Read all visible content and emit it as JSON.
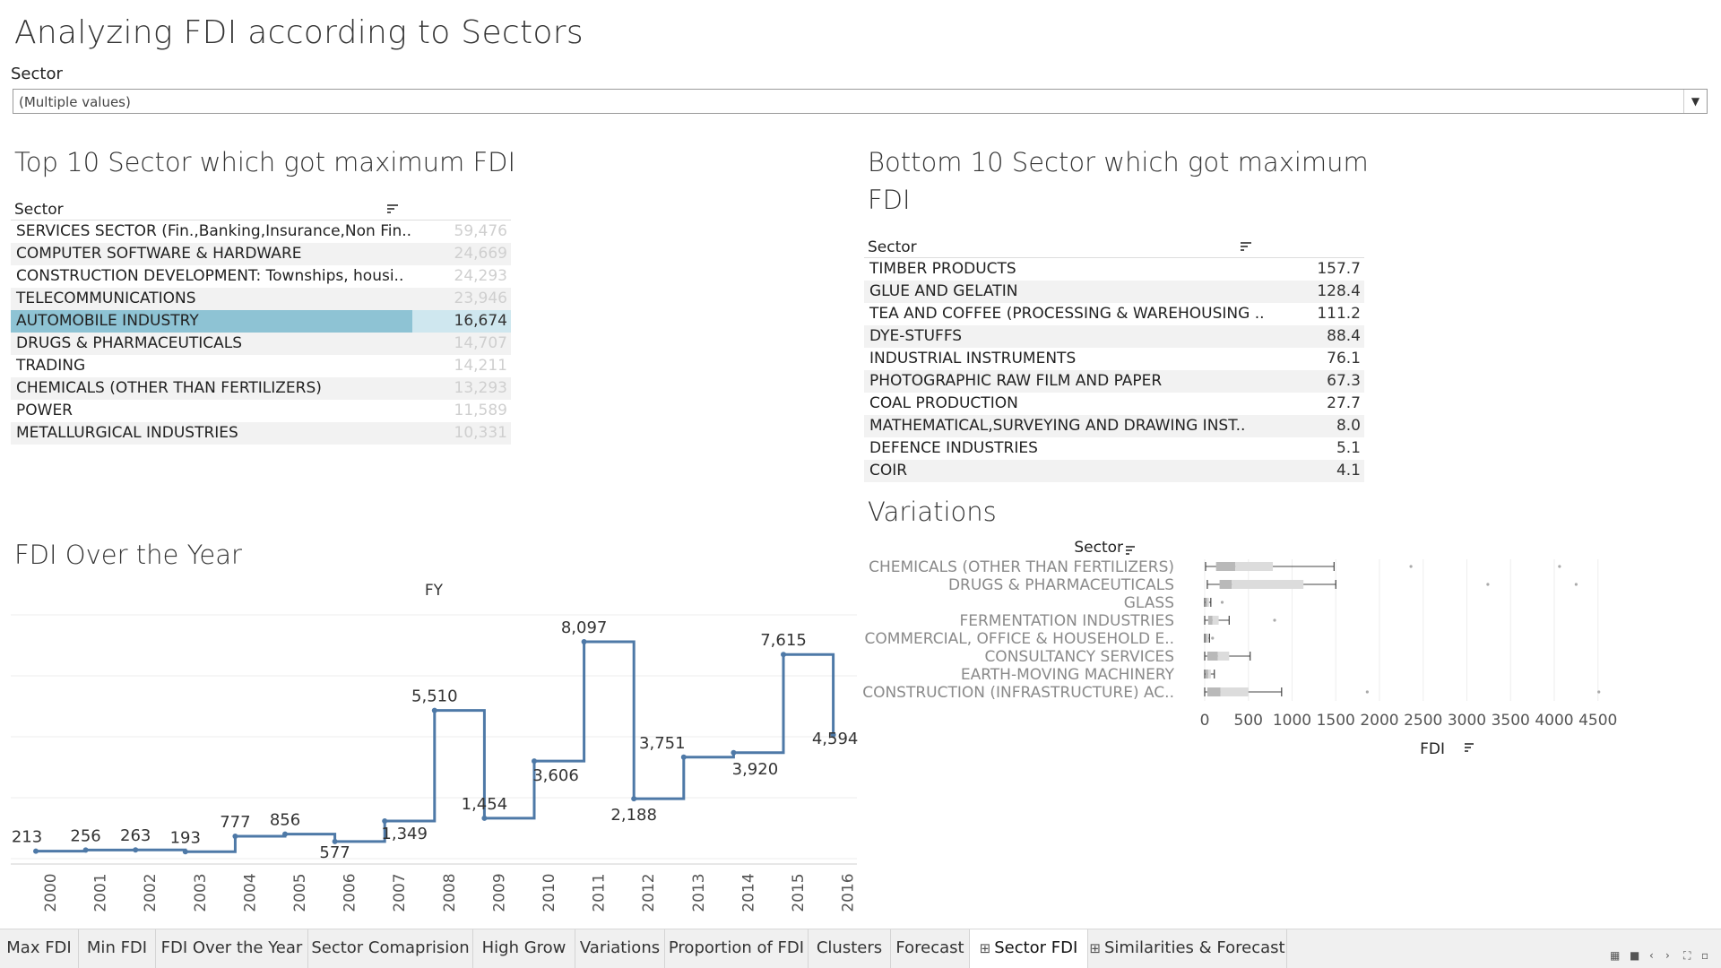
{
  "title": "Analyzing FDI according to Sectors",
  "filter": {
    "label": "Sector",
    "value": "(Multiple values)"
  },
  "top10": {
    "title": "Top 10 Sector which got maximum FDI",
    "header": "Sector",
    "rows": [
      {
        "name": "SERVICES SECTOR (Fin.,Banking,Insurance,Non Fin..",
        "value": "59,476"
      },
      {
        "name": "COMPUTER SOFTWARE & HARDWARE",
        "value": "24,669"
      },
      {
        "name": "CONSTRUCTION DEVELOPMENT: Townships, housi..",
        "value": "24,293"
      },
      {
        "name": "TELECOMMUNICATIONS",
        "value": "23,946"
      },
      {
        "name": "AUTOMOBILE INDUSTRY",
        "value": "16,674"
      },
      {
        "name": "DRUGS & PHARMACEUTICALS",
        "value": "14,707"
      },
      {
        "name": "TRADING",
        "value": "14,211"
      },
      {
        "name": "CHEMICALS (OTHER THAN FERTILIZERS)",
        "value": "13,293"
      },
      {
        "name": "POWER",
        "value": "11,589"
      },
      {
        "name": "METALLURGICAL INDUSTRIES",
        "value": "10,331"
      }
    ]
  },
  "bottom10": {
    "title_line1": "Bottom 10 Sector which got maximum",
    "title_line2": "FDI",
    "header": "Sector",
    "rows": [
      {
        "name": "TIMBER PRODUCTS",
        "value": "157.7"
      },
      {
        "name": "GLUE AND GELATIN",
        "value": "128.4"
      },
      {
        "name": "TEA AND COFFEE (PROCESSING & WAREHOUSING ..",
        "value": "111.2"
      },
      {
        "name": "DYE-STUFFS",
        "value": "88.4"
      },
      {
        "name": "INDUSTRIAL INSTRUMENTS",
        "value": "76.1"
      },
      {
        "name": "PHOTOGRAPHIC RAW FILM AND PAPER",
        "value": "67.3"
      },
      {
        "name": "COAL PRODUCTION",
        "value": "27.7"
      },
      {
        "name": "MATHEMATICAL,SURVEYING AND DRAWING INST..",
        "value": "8.0"
      },
      {
        "name": "DEFENCE INDUSTRIES",
        "value": "5.1"
      },
      {
        "name": "COIR",
        "value": "4.1"
      }
    ]
  },
  "chart_data": [
    {
      "type": "line",
      "title": "FDI Over the Year",
      "xlabel": "FY",
      "ylabel": "",
      "step": true,
      "x": [
        "2000",
        "2001",
        "2002",
        "2003",
        "2004",
        "2005",
        "2006",
        "2007",
        "2008",
        "2009",
        "2010",
        "2011",
        "2012",
        "2013",
        "2014",
        "2015",
        "2016"
      ],
      "values": [
        213,
        256,
        263,
        193,
        777,
        856,
        577,
        1349,
        5510,
        1454,
        3606,
        8097,
        2188,
        3751,
        3920,
        7615,
        4594
      ],
      "labels": [
        "213",
        "256",
        "263",
        "193",
        "777",
        "856",
        "577",
        "1,349",
        "5,510",
        "1,454",
        "3,606",
        "8,097",
        "2,188",
        "3,751",
        "3,920",
        "7,615",
        "4,594"
      ],
      "ylim": [
        0,
        8500
      ],
      "grid": true,
      "color": "#4e79a7"
    },
    {
      "type": "boxplot",
      "title": "Variations",
      "ylabel": "Sector",
      "xlabel": "FDI",
      "xlim": [
        0,
        4700
      ],
      "ticks": [
        "0",
        "500",
        "1000",
        "1500",
        "2000",
        "2500",
        "3000",
        "3500",
        "4000",
        "4500"
      ],
      "tick_values": [
        0,
        500,
        1000,
        1500,
        2000,
        2500,
        3000,
        3500,
        4000,
        4500
      ],
      "categories": [
        "CHEMICALS (OTHER THAN FERTILIZERS)",
        "DRUGS & PHARMACEUTICALS",
        "GLASS",
        "FERMENTATION INDUSTRIES",
        "COMMERCIAL, OFFICE & HOUSEHOLD E..",
        "CONSULTANCY SERVICES",
        "EARTH-MOVING MACHINERY",
        "CONSTRUCTION (INFRASTRUCTURE) AC.."
      ],
      "boxes": [
        {
          "lower": 10,
          "q1": 130,
          "median": 350,
          "q3": 780,
          "upper": 1480,
          "outliers": [
            2360,
            4060
          ]
        },
        {
          "lower": 30,
          "q1": 170,
          "median": 310,
          "q3": 1130,
          "upper": 1500,
          "outliers": [
            3240,
            4250
          ]
        },
        {
          "lower": 0,
          "q1": 10,
          "median": 30,
          "q3": 50,
          "upper": 70,
          "outliers": [
            200
          ]
        },
        {
          "lower": 0,
          "q1": 40,
          "median": 90,
          "q3": 160,
          "upper": 280,
          "outliers": [
            800
          ]
        },
        {
          "lower": 0,
          "q1": 5,
          "median": 25,
          "q3": 45,
          "upper": 55,
          "outliers": [
            90
          ]
        },
        {
          "lower": 0,
          "q1": 30,
          "median": 150,
          "q3": 280,
          "upper": 520,
          "outliers": []
        },
        {
          "lower": 0,
          "q1": 10,
          "median": 40,
          "q3": 70,
          "upper": 110,
          "outliers": []
        },
        {
          "lower": 0,
          "q1": 30,
          "median": 180,
          "q3": 500,
          "upper": 880,
          "outliers": [
            1860,
            4510
          ]
        }
      ]
    }
  ],
  "tabs": [
    {
      "label": "Max FDI",
      "active": false,
      "icon": ""
    },
    {
      "label": "Min FDI",
      "active": false,
      "icon": ""
    },
    {
      "label": "FDI Over the Year",
      "active": false,
      "icon": ""
    },
    {
      "label": "Sector Comaprision",
      "active": false,
      "icon": ""
    },
    {
      "label": "High Grow",
      "active": false,
      "icon": ""
    },
    {
      "label": "Variations",
      "active": false,
      "icon": ""
    },
    {
      "label": "Proportion of FDI",
      "active": false,
      "icon": ""
    },
    {
      "label": "Clusters",
      "active": false,
      "icon": ""
    },
    {
      "label": "Forecast",
      "active": false,
      "icon": ""
    },
    {
      "label": "Sector FDI",
      "active": true,
      "icon": "dashboard-icon"
    },
    {
      "label": "Similarities & Forecast",
      "active": false,
      "icon": "dashboard-icon"
    }
  ]
}
